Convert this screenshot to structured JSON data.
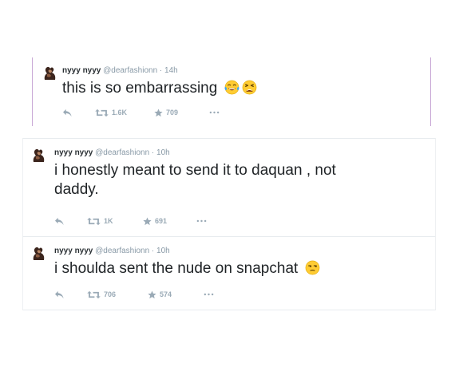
{
  "icons": {
    "reply": "reply-arrow-icon",
    "retweet": "retweet-icon",
    "favorite": "star-icon",
    "more": "ellipsis-icon"
  },
  "colors": {
    "name": "#292f33",
    "meta": "#8899a6",
    "text": "#1f2326",
    "action": "#9aaab6",
    "highlight_border": "#c9a9d6"
  },
  "tweets": [
    {
      "display_name": "nyyy nyyy",
      "handle": "@dearfashionn",
      "separator": "·",
      "time": "14h",
      "text": "this is so embarrassing",
      "emojis": [
        "face-with-tears-of-joy",
        "weary-face"
      ],
      "retweets": "1.6K",
      "favorites": "709"
    },
    {
      "display_name": "nyyy nyyy",
      "handle": "@dearfashionn",
      "separator": "·",
      "time": "10h",
      "text_line1": "i honestly meant to send it to daquan , not",
      "text_line2": "daddy.",
      "retweets": "1K",
      "favorites": "691"
    },
    {
      "display_name": "nyyy nyyy",
      "handle": "@dearfashionn",
      "separator": "·",
      "time": "10h",
      "text": "i shoulda sent the nude on snapchat",
      "emojis": [
        "unamused-face"
      ],
      "retweets": "706",
      "favorites": "574"
    }
  ]
}
